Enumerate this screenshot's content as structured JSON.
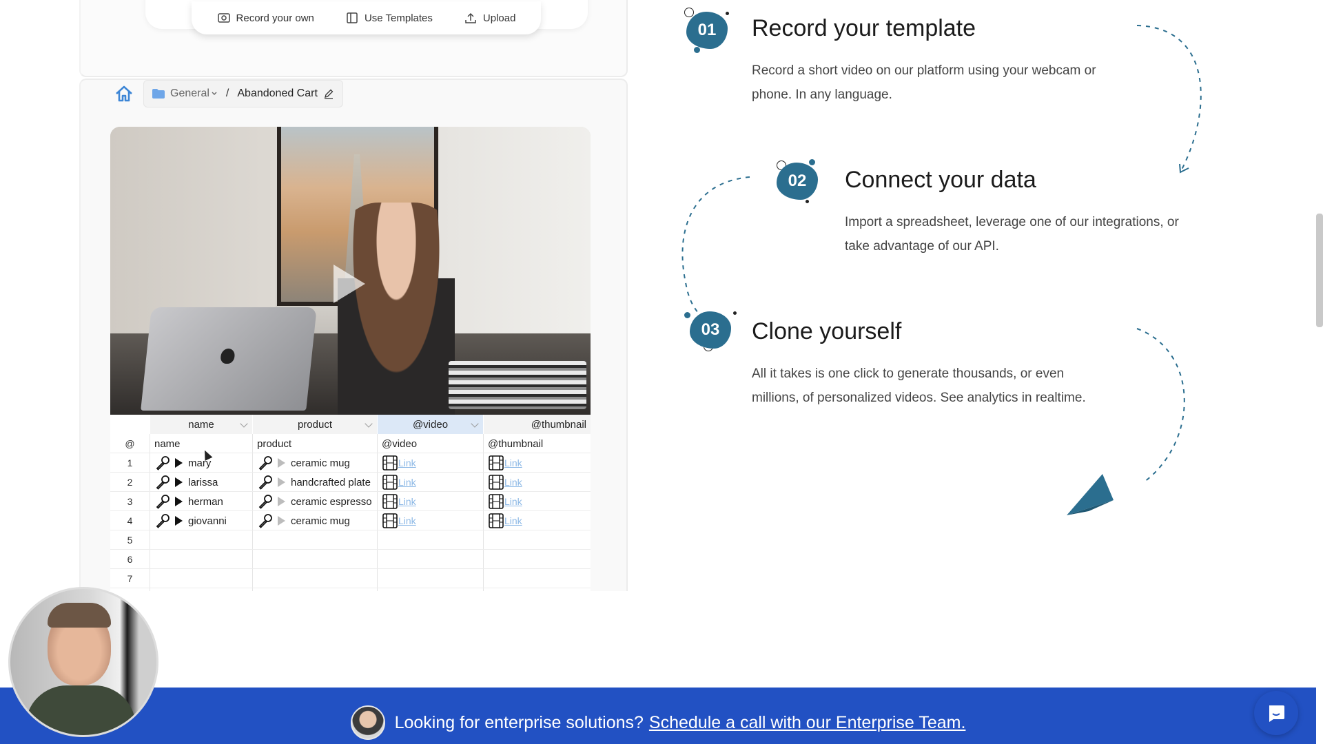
{
  "toolbar": {
    "record_label": "Record your own",
    "templates_label": "Use Templates",
    "upload_label": "Upload"
  },
  "breadcrumb": {
    "folder": "General",
    "separator": "/",
    "current": "Abandoned Cart"
  },
  "sheet": {
    "top_headers": [
      "name",
      "product",
      "@video",
      "@thumbnail"
    ],
    "columns": [
      "@",
      "name",
      "product",
      "@video",
      "@thumbnail"
    ],
    "rows": [
      {
        "num": "1",
        "name": "mary",
        "product": "ceramic mug",
        "video": "Link",
        "thumb": "Link"
      },
      {
        "num": "2",
        "name": "larissa",
        "product": "handcrafted plate",
        "video": "Link",
        "thumb": "Link"
      },
      {
        "num": "3",
        "name": "herman",
        "product": "ceramic espresso",
        "video": "Link",
        "thumb": "Link"
      },
      {
        "num": "4",
        "name": "giovanni",
        "product": "ceramic mug",
        "video": "Link",
        "thumb": "Link"
      },
      {
        "num": "5"
      },
      {
        "num": "6"
      },
      {
        "num": "7"
      }
    ]
  },
  "steps": [
    {
      "num": "01",
      "title": "Record your template",
      "desc_line1": "Record a short video on our platform using your webcam or",
      "desc_line2": "phone. In any language."
    },
    {
      "num": "02",
      "title": "Connect your data",
      "desc_line1": "Import a spreadsheet, leverage one of our integrations, or",
      "desc_line2": "take advantage of our API."
    },
    {
      "num": "03",
      "title": "Clone yourself",
      "desc_line1": "All it takes is one click to generate thousands, or even",
      "desc_line2": "millions, of personalized videos. See analytics in realtime."
    }
  ],
  "banner": {
    "text": "Looking for enterprise solutions?",
    "cta": "Schedule a call with our Enterprise Team."
  },
  "colors": {
    "accent": "#2b6e8f",
    "banner": "#2251c3",
    "link": "#8cb8e6"
  },
  "icons": [
    "record-icon",
    "template-icon",
    "upload-icon",
    "home-icon",
    "folder-icon",
    "pencil-icon",
    "play-icon",
    "microphone-icon",
    "film-icon",
    "paper-plane-icon",
    "chat-icon"
  ]
}
